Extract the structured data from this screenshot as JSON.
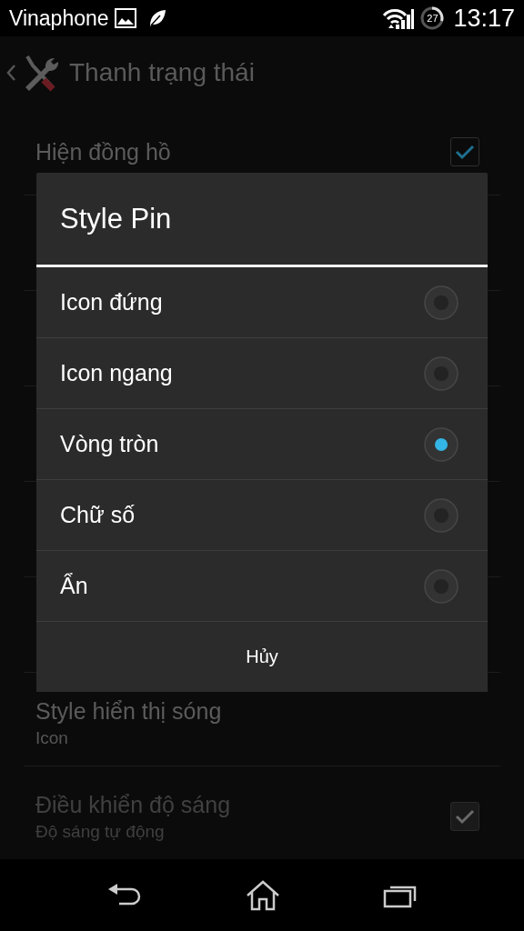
{
  "status_bar": {
    "carrier": "Vinaphone",
    "battery": "27",
    "time": "13:17"
  },
  "action_bar": {
    "title": "Thanh trạng thái"
  },
  "settings": [
    {
      "kind": "checkbox",
      "title": "Hiện đồng hồ",
      "checked": true,
      "disabled": false
    },
    {
      "kind": "summary",
      "title": "Style hiển thị sóng",
      "summary": "Icon"
    },
    {
      "kind": "checkbox",
      "title": "Điều khiển độ sáng",
      "summary": "Độ sáng tự động",
      "checked": true,
      "disabled": true
    }
  ],
  "dialog": {
    "title": "Style Pin",
    "options": [
      {
        "label": "Icon đứng",
        "selected": false
      },
      {
        "label": "Icon ngang",
        "selected": false
      },
      {
        "label": "Vòng tròn",
        "selected": true
      },
      {
        "label": "Chữ số",
        "selected": false
      },
      {
        "label": "Ẩn",
        "selected": false
      }
    ],
    "cancel": "Hủy"
  }
}
